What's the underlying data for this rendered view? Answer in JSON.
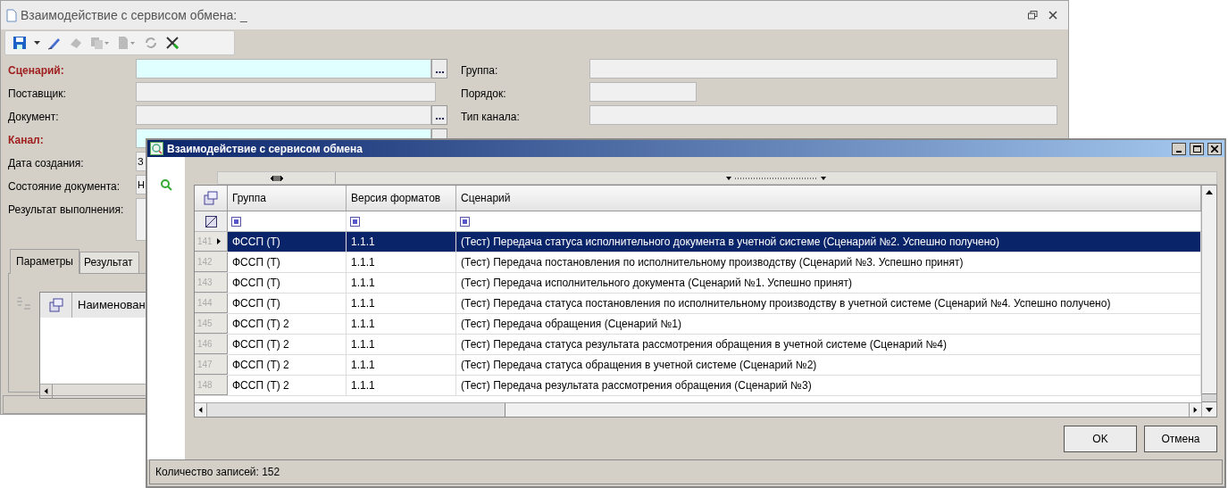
{
  "main_window": {
    "title": "Взаимодействие с сервисом обмена: _",
    "fields": [
      {
        "label": "Сценарий:",
        "required": true,
        "has_button": true,
        "kind": "lookup"
      },
      {
        "label": "Поставщик:",
        "required": false,
        "has_button": false,
        "kind": "text"
      },
      {
        "label": "Документ:",
        "required": false,
        "has_button": true,
        "kind": "lookup"
      },
      {
        "label": "Канал:",
        "required": true,
        "has_button": true,
        "kind": "lookup"
      },
      {
        "label": "Дата создания:",
        "required": false,
        "value": "З",
        "kind": "short"
      },
      {
        "label": "Состояние документа:",
        "required": false,
        "value": "Н",
        "kind": "short"
      },
      {
        "label": "Результат выполнения:",
        "required": false,
        "kind": "memo"
      }
    ],
    "right_fields": [
      {
        "label": "Группа:",
        "kind": "wide"
      },
      {
        "label": "Порядок:",
        "kind": "narrow"
      },
      {
        "label": "Тип канала:",
        "kind": "wide"
      }
    ],
    "tabs": [
      {
        "label": "Параметры",
        "selected": true
      },
      {
        "label": "Результат",
        "selected": false
      }
    ],
    "params_columns": [
      "Наименован"
    ]
  },
  "dialog": {
    "title": "Взаимодействие с сервисом обмена",
    "columns": [
      "Группа",
      "Версия форматов",
      "Сценарий"
    ],
    "rows": [
      {
        "number": "141",
        "group": "ФССП (Т)",
        "version": "1.1.1",
        "scenario": "(Тест) Передача статуса исполнительного документа в учетной системе (Сценарий №2. Успешно получено)",
        "selected": true
      },
      {
        "number": "142",
        "group": "ФССП (Т)",
        "version": "1.1.1",
        "scenario": "(Тест) Передача постановления по исполнительному производству (Сценарий №3. Успешно принят)",
        "selected": false
      },
      {
        "number": "143",
        "group": "ФССП (Т)",
        "version": "1.1.1",
        "scenario": "(Тест) Передача исполнительного документа (Сценарий №1. Успешно принят)",
        "selected": false
      },
      {
        "number": "144",
        "group": "ФССП (Т)",
        "version": "1.1.1",
        "scenario": "(Тест) Передача статуса постановления по исполнительному производству в учетной системе (Сценарий №4. Успешно получено)",
        "selected": false
      },
      {
        "number": "145",
        "group": "ФССП (Т) 2",
        "version": "1.1.1",
        "scenario": "(Тест) Передача обращения (Сценарий №1)",
        "selected": false
      },
      {
        "number": "146",
        "group": "ФССП (Т) 2",
        "version": "1.1.1",
        "scenario": "(Тест) Передача статуса результата рассмотрения обращения в учетной системе (Сценарий №4)",
        "selected": false
      },
      {
        "number": "147",
        "group": "ФССП (Т) 2",
        "version": "1.1.1",
        "scenario": "(Тест) Передача статуса обращения в учетной системе (Сценарий №2)",
        "selected": false
      },
      {
        "number": "148",
        "group": "ФССП (Т) 2",
        "version": "1.1.1",
        "scenario": "(Тест) Передача результата рассмотрения обращения (Сценарий №3)",
        "selected": false
      }
    ],
    "buttons": [
      "OK",
      "Отмена"
    ],
    "status": "Количество записей: 152"
  }
}
